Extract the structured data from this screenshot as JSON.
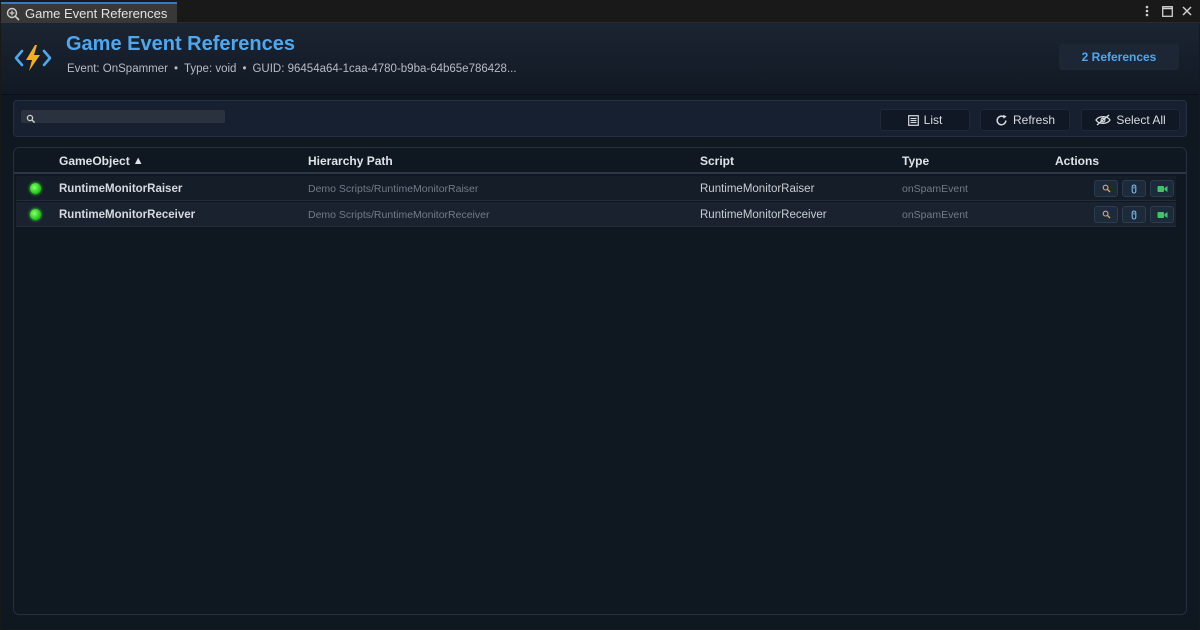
{
  "tab": {
    "title": "Game Event References",
    "icon": "inspect-icon"
  },
  "window_controls": [
    "menu-icon",
    "maximize-icon",
    "close-icon"
  ],
  "header": {
    "title": "Game Event References",
    "event_label": "Event: OnSpammer",
    "type_label": "Type: void",
    "guid_label": "GUID: 96454a64-1caa-4780-b9ba-64b65e786428...",
    "separator": "•",
    "reference_count": "2 References",
    "logo_icon": "game-event-bolt-icon"
  },
  "toolbar": {
    "search_value": "",
    "search_icon": "search-icon",
    "list_label": "List",
    "refresh_label": "Refresh",
    "select_all_label": "Select All"
  },
  "table": {
    "columns": {
      "gameobject": "GameObject",
      "sort_indicator": "▲",
      "hierarchy_path": "Hierarchy Path",
      "script": "Script",
      "type": "Type",
      "actions": "Actions"
    },
    "rows": [
      {
        "status": "active",
        "gameobject": "RuntimeMonitorRaiser",
        "hierarchy_path": "Demo Scripts/RuntimeMonitorRaiser",
        "script": "RuntimeMonitorRaiser",
        "type": "onSpamEvent",
        "actions": [
          "ping-icon",
          "select-icon",
          "focus-camera-icon"
        ]
      },
      {
        "status": "active",
        "gameobject": "RuntimeMonitorReceiver",
        "hierarchy_path": "Demo Scripts/RuntimeMonitorReceiver",
        "script": "RuntimeMonitorReceiver",
        "type": "onSpamEvent",
        "actions": [
          "ping-icon",
          "select-icon",
          "focus-camera-icon"
        ]
      }
    ]
  },
  "colors": {
    "accent": "#4fa8ef",
    "status_active": "#2bd11c",
    "background": "#0f1721"
  }
}
